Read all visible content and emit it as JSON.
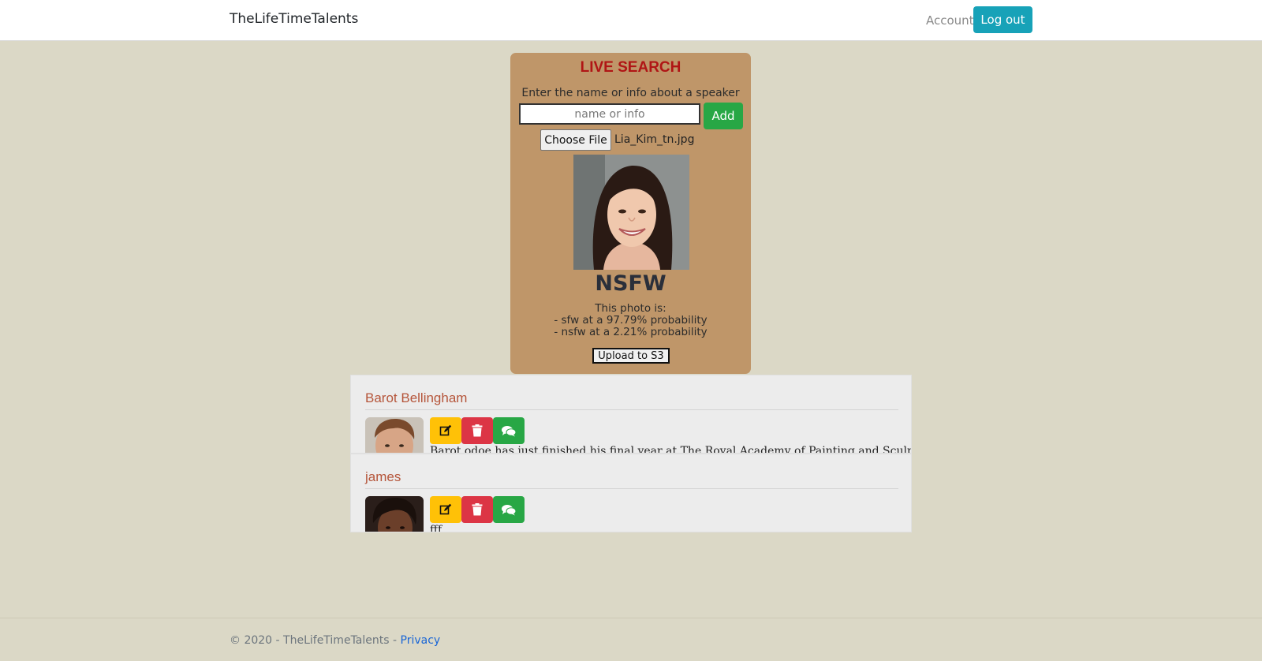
{
  "navbar": {
    "brand": "TheLifeTimeTalents",
    "account_label": "Account",
    "logout_label": "Log out"
  },
  "search_panel": {
    "title": "LIVE SEARCH",
    "instructions": "Enter the name or info about a speaker",
    "input_placeholder": "name or info",
    "input_value": "",
    "add_label": "Add",
    "choose_file_label": "Choose File",
    "selected_file": "Lia_Kim_tn.jpg",
    "classification": "NSFW",
    "result_intro": "This photo is:",
    "result_sfw": "- sfw at a 97.79% probability",
    "result_nsfw": "- nsfw at a 2.21% probability",
    "upload_label": "Upload to S3"
  },
  "speakers": [
    {
      "name": "Barot Bellingham",
      "bio": "Barot odoe has just finished his final year at The Royal Academy of Painting and Sculpture"
    },
    {
      "name": "james",
      "bio": "fff"
    }
  ],
  "footer": {
    "copyright": "© 2020 - TheLifeTimeTalents - ",
    "privacy_label": "Privacy"
  },
  "colors": {
    "page_background": "#dbd8c6",
    "panel_background": "#bf9669",
    "title_red": "#b01515",
    "info_button": "#17a2b8",
    "success_button": "#28a745",
    "warning_button": "#ffc107",
    "danger_button": "#dc3545",
    "speaker_name": "#b5553a"
  },
  "icons": {
    "edit": "edit-icon",
    "delete": "trash-icon",
    "chat": "comments-icon"
  }
}
